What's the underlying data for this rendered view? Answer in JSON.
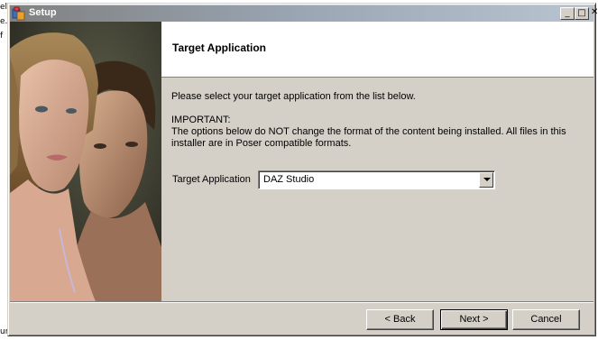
{
  "background": {
    "left_fragments": [
      "el",
      "e.",
      "f",
      "ur"
    ]
  },
  "window": {
    "title": "Setup",
    "controls": {
      "minimize": "_",
      "maximize": "□",
      "close": "✕"
    }
  },
  "header": {
    "title": "Target Application"
  },
  "body": {
    "instruction": "Please select your target application from the list below.",
    "important_label": "IMPORTANT:",
    "important_line1": "The options below do NOT change the format of the content being installed.  All files in this",
    "important_line2": "installer are in Poser compatible formats."
  },
  "target_select": {
    "label": "Target Application",
    "value": "DAZ Studio"
  },
  "buttons": {
    "back": "< Back",
    "next": "Next >",
    "cancel": "Cancel"
  },
  "icons": {
    "app": "setup-app-icon",
    "dropdown": "chevron-down-icon"
  },
  "colors": {
    "window_face": "#d4d0c8",
    "header_bg": "#ffffff",
    "title_text": "#ffffff"
  }
}
